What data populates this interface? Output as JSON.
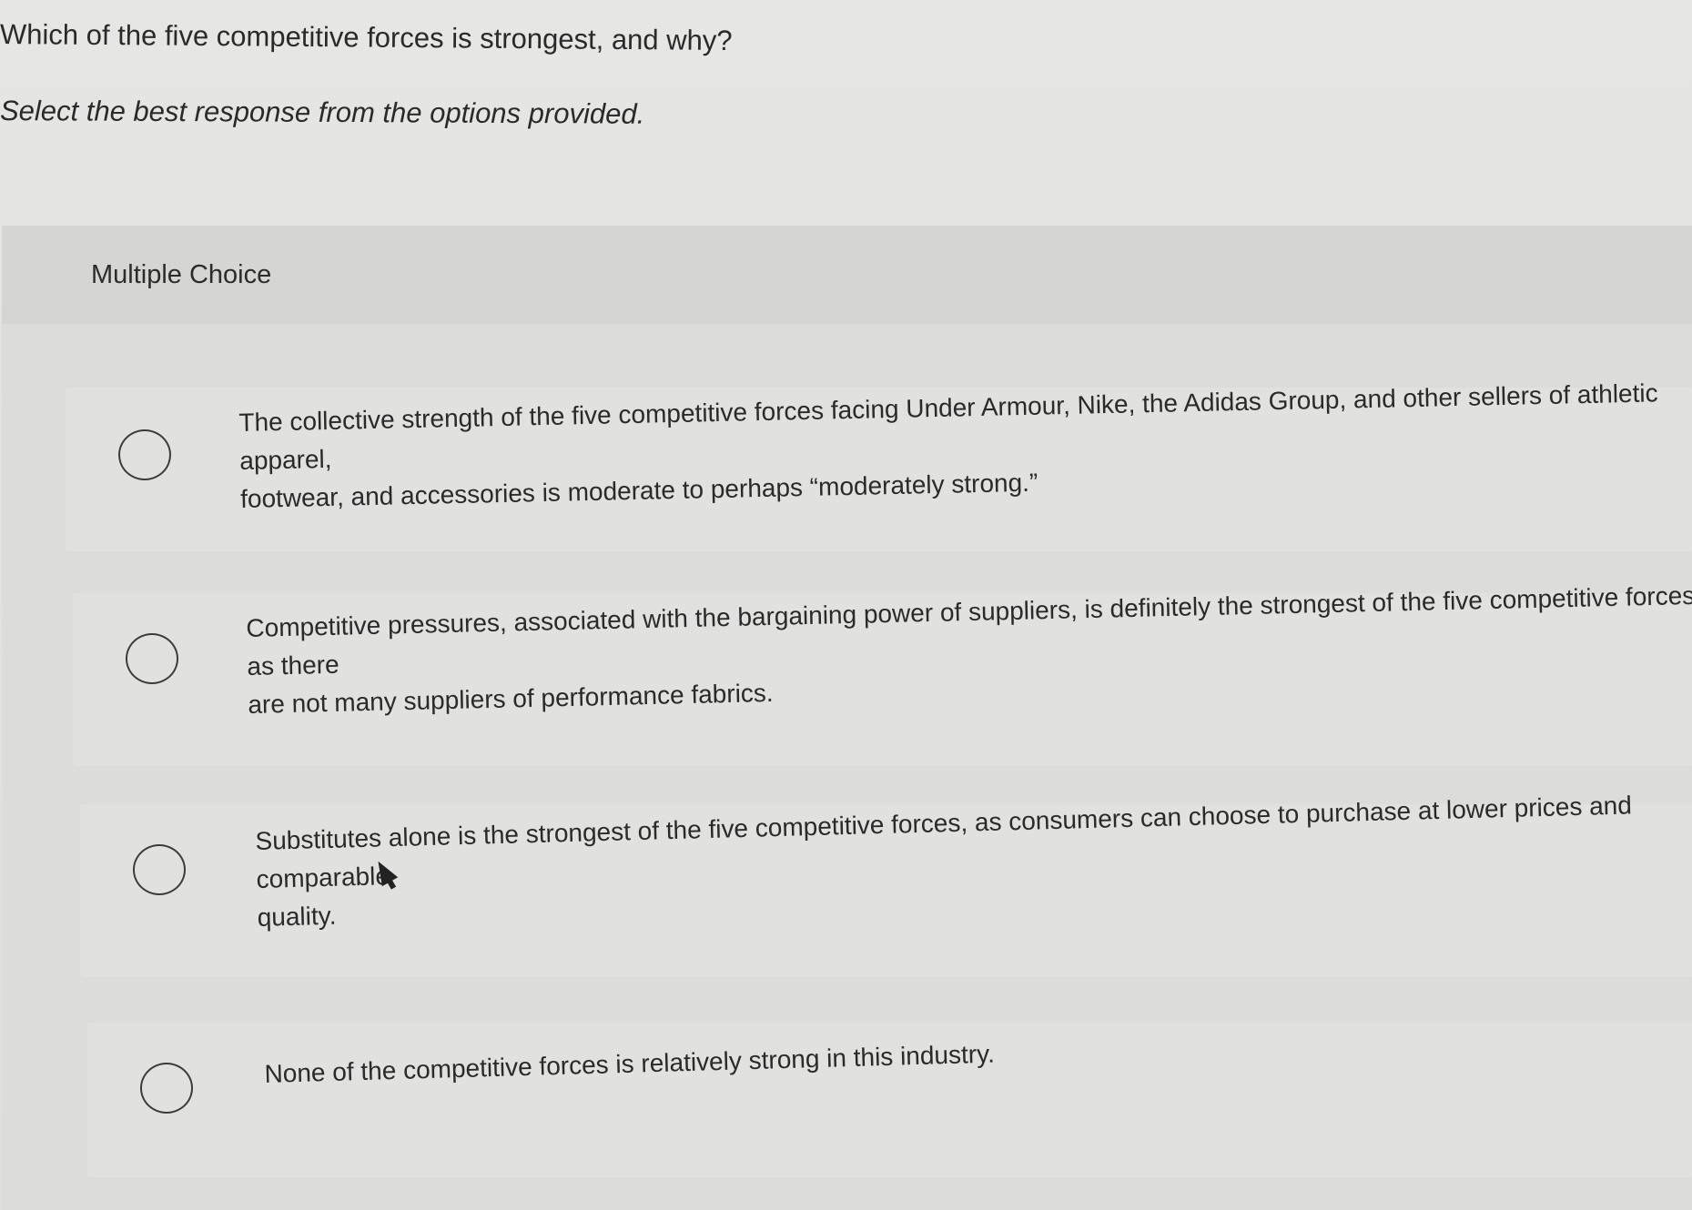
{
  "question": {
    "text": "Which of the five competitive forces is strongest, and why?",
    "instruction": "Select the best response from the options provided."
  },
  "multiple_choice": {
    "label": "Multiple Choice",
    "options": [
      {
        "text": "The collective strength of the five competitive forces facing Under Armour, Nike, the Adidas Group, and other sellers of athletic apparel,\nfootwear, and accessories is moderate to perhaps “moderately strong.”"
      },
      {
        "text": "Competitive pressures, associated with the bargaining power of suppliers, is definitely the strongest of the five competitive forces as there\nare not many suppliers of performance fabrics."
      },
      {
        "text": "Substitutes alone is the strongest of the five competitive forces, as consumers can choose to purchase at lower prices and comparable\nquality."
      },
      {
        "text": "None of the competitive forces is relatively strong in this industry."
      }
    ]
  }
}
